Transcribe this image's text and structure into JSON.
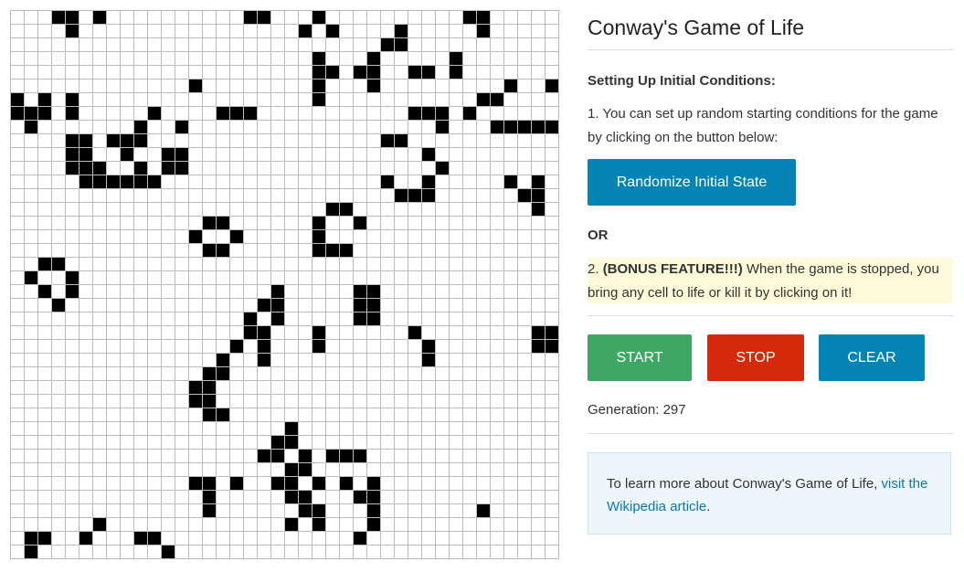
{
  "board": {
    "alive": [
      [
        0,
        3
      ],
      [
        0,
        4
      ],
      [
        0,
        6
      ],
      [
        0,
        17
      ],
      [
        0,
        18
      ],
      [
        0,
        22
      ],
      [
        0,
        33
      ],
      [
        0,
        34
      ],
      [
        1,
        4
      ],
      [
        1,
        21
      ],
      [
        1,
        23
      ],
      [
        1,
        28
      ],
      [
        1,
        34
      ],
      [
        2,
        27
      ],
      [
        2,
        28
      ],
      [
        3,
        22
      ],
      [
        3,
        26
      ],
      [
        3,
        32
      ],
      [
        4,
        22
      ],
      [
        4,
        23
      ],
      [
        4,
        25
      ],
      [
        4,
        26
      ],
      [
        4,
        29
      ],
      [
        4,
        30
      ],
      [
        4,
        32
      ],
      [
        5,
        13
      ],
      [
        5,
        22
      ],
      [
        5,
        26
      ],
      [
        5,
        36
      ],
      [
        5,
        39
      ],
      [
        6,
        0
      ],
      [
        6,
        2
      ],
      [
        6,
        4
      ],
      [
        6,
        22
      ],
      [
        6,
        34
      ],
      [
        6,
        35
      ],
      [
        7,
        0
      ],
      [
        7,
        1
      ],
      [
        7,
        2
      ],
      [
        7,
        4
      ],
      [
        7,
        10
      ],
      [
        7,
        15
      ],
      [
        7,
        16
      ],
      [
        7,
        17
      ],
      [
        7,
        29
      ],
      [
        7,
        30
      ],
      [
        7,
        31
      ],
      [
        7,
        33
      ],
      [
        8,
        1
      ],
      [
        8,
        9
      ],
      [
        8,
        12
      ],
      [
        8,
        31
      ],
      [
        8,
        35
      ],
      [
        8,
        36
      ],
      [
        8,
        37
      ],
      [
        8,
        38
      ],
      [
        8,
        39
      ],
      [
        9,
        4
      ],
      [
        9,
        5
      ],
      [
        9,
        7
      ],
      [
        9,
        8
      ],
      [
        9,
        9
      ],
      [
        9,
        27
      ],
      [
        9,
        28
      ],
      [
        10,
        4
      ],
      [
        10,
        5
      ],
      [
        10,
        8
      ],
      [
        10,
        11
      ],
      [
        10,
        12
      ],
      [
        10,
        30
      ],
      [
        11,
        4
      ],
      [
        11,
        5
      ],
      [
        11,
        6
      ],
      [
        11,
        9
      ],
      [
        11,
        11
      ],
      [
        11,
        12
      ],
      [
        11,
        31
      ],
      [
        12,
        5
      ],
      [
        12,
        6
      ],
      [
        12,
        7
      ],
      [
        12,
        8
      ],
      [
        12,
        9
      ],
      [
        12,
        10
      ],
      [
        12,
        27
      ],
      [
        12,
        30
      ],
      [
        12,
        36
      ],
      [
        12,
        38
      ],
      [
        13,
        28
      ],
      [
        13,
        29
      ],
      [
        13,
        30
      ],
      [
        13,
        37
      ],
      [
        13,
        38
      ],
      [
        14,
        23
      ],
      [
        14,
        24
      ],
      [
        14,
        38
      ],
      [
        15,
        14
      ],
      [
        15,
        15
      ],
      [
        15,
        22
      ],
      [
        15,
        25
      ],
      [
        16,
        13
      ],
      [
        16,
        16
      ],
      [
        16,
        22
      ],
      [
        17,
        14
      ],
      [
        17,
        15
      ],
      [
        17,
        22
      ],
      [
        17,
        23
      ],
      [
        17,
        24
      ],
      [
        18,
        2
      ],
      [
        18,
        3
      ],
      [
        19,
        1
      ],
      [
        19,
        4
      ],
      [
        20,
        2
      ],
      [
        20,
        4
      ],
      [
        20,
        19
      ],
      [
        20,
        25
      ],
      [
        20,
        26
      ],
      [
        21,
        3
      ],
      [
        21,
        18
      ],
      [
        21,
        19
      ],
      [
        21,
        25
      ],
      [
        21,
        26
      ],
      [
        22,
        17
      ],
      [
        22,
        19
      ],
      [
        22,
        25
      ],
      [
        22,
        26
      ],
      [
        23,
        17
      ],
      [
        23,
        18
      ],
      [
        23,
        22
      ],
      [
        23,
        29
      ],
      [
        23,
        38
      ],
      [
        23,
        39
      ],
      [
        24,
        16
      ],
      [
        24,
        18
      ],
      [
        24,
        22
      ],
      [
        24,
        30
      ],
      [
        24,
        38
      ],
      [
        24,
        39
      ],
      [
        25,
        15
      ],
      [
        25,
        18
      ],
      [
        25,
        30
      ],
      [
        26,
        15
      ],
      [
        26,
        14
      ],
      [
        27,
        14
      ],
      [
        27,
        13
      ],
      [
        28,
        13
      ],
      [
        28,
        14
      ],
      [
        29,
        14
      ],
      [
        29,
        15
      ],
      [
        30,
        20
      ],
      [
        31,
        19
      ],
      [
        31,
        20
      ],
      [
        32,
        18
      ],
      [
        32,
        19
      ],
      [
        32,
        21
      ],
      [
        32,
        23
      ],
      [
        32,
        24
      ],
      [
        32,
        25
      ],
      [
        33,
        20
      ],
      [
        33,
        21
      ],
      [
        34,
        13
      ],
      [
        34,
        14
      ],
      [
        34,
        16
      ],
      [
        34,
        19
      ],
      [
        34,
        20
      ],
      [
        34,
        22
      ],
      [
        34,
        24
      ],
      [
        34,
        26
      ],
      [
        35,
        14
      ],
      [
        35,
        20
      ],
      [
        35,
        21
      ],
      [
        35,
        25
      ],
      [
        35,
        26
      ],
      [
        36,
        14
      ],
      [
        36,
        21
      ],
      [
        36,
        22
      ],
      [
        36,
        26
      ],
      [
        36,
        34
      ],
      [
        37,
        6
      ],
      [
        37,
        20
      ],
      [
        37,
        22
      ],
      [
        37,
        26
      ],
      [
        38,
        1
      ],
      [
        38,
        2
      ],
      [
        38,
        5
      ],
      [
        38,
        9
      ],
      [
        38,
        10
      ],
      [
        38,
        25
      ],
      [
        39,
        1
      ],
      [
        39,
        11
      ]
    ]
  },
  "panel": {
    "title": "Conway's Game of Life",
    "setup_heading": "Setting Up Initial Conditions:",
    "step1": "1. You can set up random starting conditions for the game by clicking on the button below:",
    "randomize_label": "Randomize Initial State",
    "or_label": "OR",
    "bonus_prefix": "2. ",
    "bonus_bold": "(BONUS FEATURE!!!)",
    "bonus_text": " When the game is stopped, you bring any cell to life or kill it by clicking on it!",
    "start_label": "START",
    "stop_label": "STOP",
    "clear_label": "CLEAR",
    "generation_label": "Generation: ",
    "generation_value": "297",
    "info_text": "To learn more about Conway's Game of Life, ",
    "info_link": "visit the Wikipedia article",
    "info_end": "."
  },
  "colors": {
    "start": "#3da866",
    "stop": "#d5290e",
    "clear": "#0285b5",
    "randomize": "#0285b5",
    "bonus_bg": "#fdfbd9",
    "info_bg": "#edf6fb",
    "link": "#0b77b4"
  }
}
